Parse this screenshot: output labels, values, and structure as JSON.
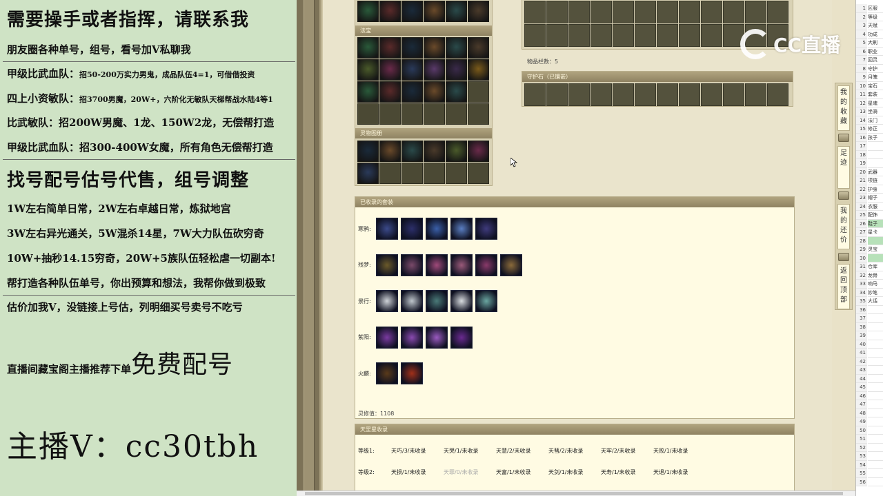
{
  "overlay": {
    "title": "需要操手或者指挥，请联系我",
    "line1": "朋友圈各种单号，组号，看号加V私聊我",
    "line2_head": "甲级比武血队：",
    "line2_tail": "招50-200万实力男鬼，成品队伍4=1，可借借投资",
    "line3_head": "四上小资敏队：",
    "line3_tail": "招3700男魔，20W+，六阶化无敏队天梯帮战水陆4等1",
    "line4": "比武敏队：招200W男魔、1龙、150W2龙，无偿帮打造",
    "line5": "甲级比武血队：招300-400W女魔，所有角色无偿帮打造",
    "heading2": "找号配号估号代售，组号调整",
    "line6": "1W左右简单日常，2W左右卓越日常，炼狱地宫",
    "line7": "3W左右异光通关，5W混杀14星，7W大力队伍砍穷奇",
    "line8": "10W+抽秒14.15穷奇，20W+5族队伍轻松虐一切副本!",
    "line9": "帮打造各种队伍单号，你出预算和想法，我帮你做到极致",
    "line10": "估价加我V，没链接上号估，列明细买号卖号不吃亏",
    "promo_small": "直播间藏宝阁主播推荐下单",
    "promo_big": "免费配号",
    "anchor": "主播V：cc30tbh"
  },
  "game": {
    "fabao_header": "法宝",
    "pet_header": "灵物图册",
    "item_count": "物品栏数：5",
    "guardian_header": "守护石（已镶嵌）",
    "sets_header": "已收录的套装",
    "sets": [
      {
        "name": "寒鸦:",
        "count": 5,
        "colors": [
          "#3b4a8a",
          "#2c2f6a",
          "#3a5fa8",
          "#5a7ec2",
          "#3e3a7c"
        ]
      },
      {
        "name": "残梦:",
        "count": 6,
        "colors": [
          "#6b5a2a",
          "#7a4a6a",
          "#a04a7a",
          "#9a5a7a",
          "#8a3a6a",
          "#8a6a3a"
        ]
      },
      {
        "name": "景行:",
        "count": 5,
        "colors": [
          "#cfd3d8",
          "#bfc6cc",
          "#4a7a78",
          "#d9dde0",
          "#6aa6a0"
        ]
      },
      {
        "name": "紫阳:",
        "count": 4,
        "colors": [
          "#7a3aa0",
          "#8a4ab0",
          "#9a5ac0",
          "#6a2a90"
        ]
      },
      {
        "name": "火麟:",
        "count": 2,
        "colors": [
          "#5a3a1a",
          "#a0301a"
        ]
      }
    ],
    "lingxiu": "灵修值：1108",
    "tiangang_header": "天罡星收录",
    "tiangang_rows": [
      {
        "label": "等级1:",
        "items": [
          "天巧/3/未收录",
          "天哭/1/未收录",
          "天慧/2/未收录",
          "天彗/2/未收录",
          "天牢/2/未收录",
          "天败/1/未收录"
        ]
      },
      {
        "label": "等级2:",
        "items": [
          "天损/1/未收录",
          "天罪/0/未收录",
          "天富/1/未收录",
          "天剑/1/未收录",
          "天寿/1/未收录",
          "天退/1/未收录"
        ]
      }
    ],
    "side_nav": [
      "我的收藏",
      "足迹",
      "我的还价",
      "返回顶部"
    ]
  },
  "logo": {
    "text": "CC直播"
  },
  "sheet": {
    "row_numbers": [
      "1",
      "2",
      "3",
      "4",
      "5",
      "6",
      "7",
      "8",
      "9",
      "10",
      "11",
      "12",
      "13",
      "14",
      "15",
      "16",
      "17",
      "18",
      "19",
      "20",
      "21",
      "22",
      "23",
      "24",
      "25",
      "26",
      "27",
      "28",
      "29",
      "30",
      "31",
      "32",
      "33",
      "34",
      "35",
      "36",
      "37",
      "38",
      "39",
      "40",
      "41",
      "42",
      "43",
      "44",
      "45",
      "46",
      "47",
      "48",
      "49",
      "50",
      "51",
      "52",
      "53",
      "54",
      "55",
      "56"
    ],
    "cells": [
      "区服",
      "等级",
      "天赋",
      "功成",
      "大刷",
      "职业",
      "回灵",
      "守护",
      "月魄",
      "宝石",
      "套装",
      "星魂",
      "坐骑",
      "法门",
      "修正",
      "孩子",
      "",
      "",
      "",
      "武器",
      "项链",
      "护身",
      "帽子",
      "衣服",
      "配饰",
      "鞋子",
      "星卡",
      "",
      "灵宝",
      "",
      "仓库",
      "龙骨",
      "响马",
      "妙笔",
      "大话"
    ]
  }
}
